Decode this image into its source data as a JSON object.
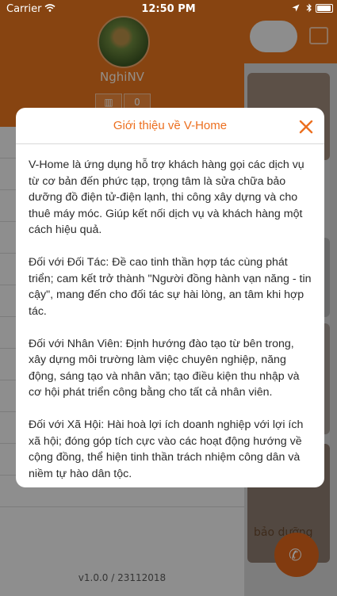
{
  "status_bar": {
    "carrier": "Carrier",
    "time": "12:50 PM",
    "icons": [
      "wifi-icon",
      "location-icon",
      "bluetooth-icon",
      "battery-icon"
    ]
  },
  "drawer": {
    "username": "NghiNV",
    "stat_count": "0",
    "version": "v1.0.0 / 23112018"
  },
  "background": {
    "card_text": "bảo dưỡng"
  },
  "modal": {
    "title": "Giới thiệu về V-Home",
    "paragraphs": [
      "V-Home là ứng dụng hỗ trợ khách hàng gọi các dịch vụ từ cơ bản đến phức tạp, trọng tâm là sửa chữa bảo dưỡng đồ điện tử-điện lạnh, thi công xây dựng và cho thuê máy móc. Giúp kết nối dịch vụ và khách hàng một cách hiệu quả.",
      " Đối với Đối Tác: Đề cao tinh thần hợp tác cùng phát triển; cam kết trở thành \"Người đồng hành vạn năng - tin cậy\", mang đến cho đối tác sự hài lòng, an tâm khi hợp tác.",
      " Đối với Nhân Viên: Định hướng đào tạo từ bên trong, xây dựng môi trường làm việc chuyên nghiệp, năng động, sáng tạo và nhân văn; tạo điều kiện thu nhập và cơ hội phát triển công bằng cho tất cả nhân viên.",
      " Đối với Xã Hội: Hài hoà lợi ích doanh nghiệp với lợi ích xã hội; đóng góp tích cực vào các hoạt động hướng về cộng đồng, thể hiện tinh thần trách nhiệm công dân và niềm tự hào dân tộc."
    ]
  },
  "colors": {
    "accent": "#ec6f1f",
    "header": "#e8761e"
  }
}
